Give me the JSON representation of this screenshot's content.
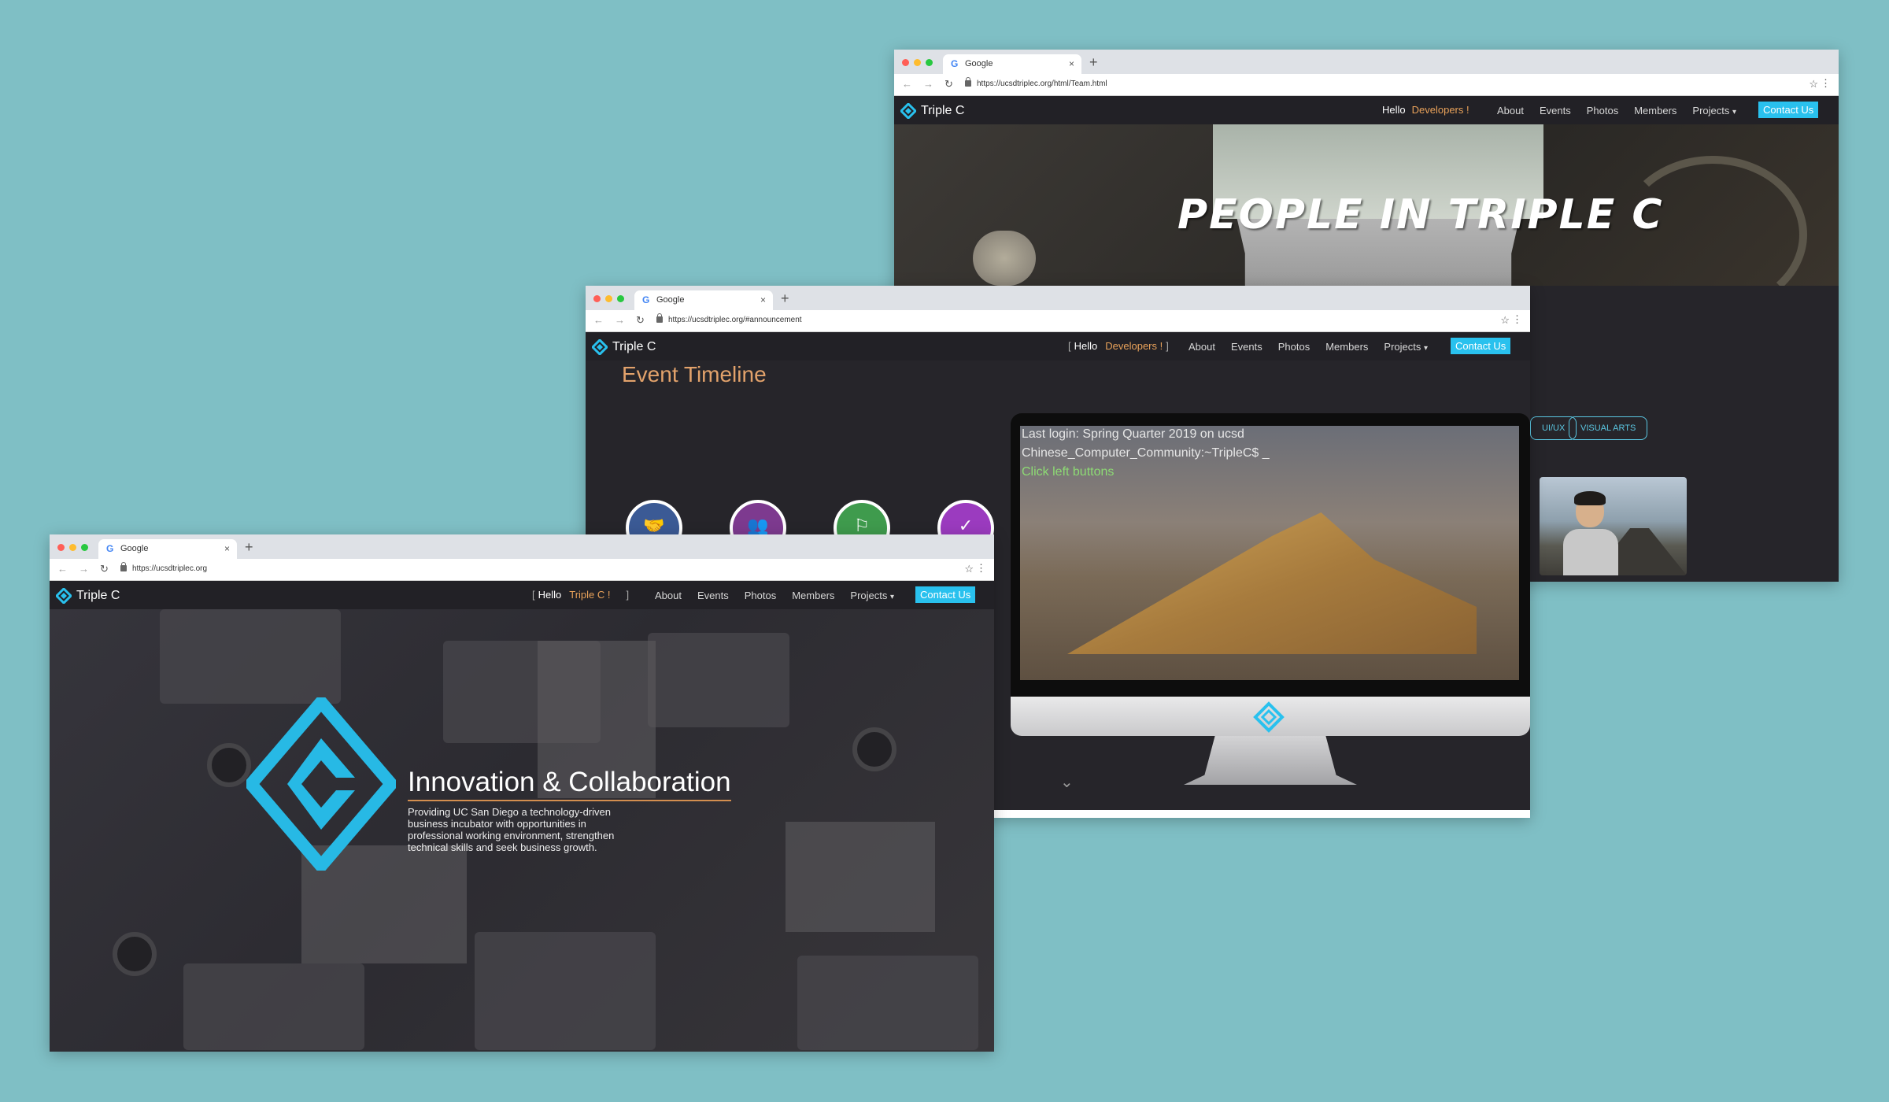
{
  "colors": {
    "background": "#7fbfc5",
    "accent": "#29c1ee",
    "highlight": "#e9a25a",
    "dark": "#26252a"
  },
  "windows": {
    "team": {
      "tab_title": "Google",
      "url": "https://ucsdtriplec.org/html/Team.html",
      "brand": "Triple C",
      "hello": "Hello",
      "hello_highlight": "Developers !",
      "nav": [
        "About",
        "Events",
        "Photos",
        "Members",
        "Projects"
      ],
      "contact": "Contact Us",
      "hero_title": "PEOPLE IN TRIPLE C",
      "filters": [
        "UI/UX",
        "VISUAL ARTS"
      ]
    },
    "announcement": {
      "tab_title": "Google",
      "url": "https://ucsdtriplec.org/#announcement",
      "brand": "Triple C",
      "bracket_open": "[",
      "hello": "Hello",
      "hello_highlight": "Developers !",
      "bracket_close": "]",
      "nav": [
        "About",
        "Events",
        "Photos",
        "Members",
        "Projects"
      ],
      "contact": "Contact Us",
      "section_title": "Event Timeline",
      "terminal": [
        "Last login: Spring Quarter 2019 on ucsd",
        "Chinese_Computer_Community:~TripleC$ _",
        "Click left buttons"
      ],
      "timeline_icons": [
        {
          "name": "handshake-icon",
          "glyph": "🤝",
          "color": "#3b5a95"
        },
        {
          "name": "group-icon",
          "glyph": "👥",
          "color": "#7d3a8f"
        },
        {
          "name": "map-icon",
          "glyph": "⚐",
          "color": "#3f9b4d"
        },
        {
          "name": "check-icon",
          "glyph": "✓",
          "color": "#9b3bbf"
        }
      ]
    },
    "home": {
      "tab_title": "Google",
      "url": "https://ucsdtriplec.org",
      "brand": "Triple C",
      "bracket_open": "[",
      "hello": "Hello",
      "hello_highlight": "Triple C !",
      "bracket_close": "]",
      "nav": [
        "About",
        "Events",
        "Photos",
        "Members",
        "Projects"
      ],
      "contact": "Contact Us",
      "hero_title": "Innovation & Collaboration",
      "hero_subtitle": "Providing UC San Diego a technology-driven business incubator with opportunities in professional working environment, strengthen technical skills and seek business growth."
    }
  }
}
